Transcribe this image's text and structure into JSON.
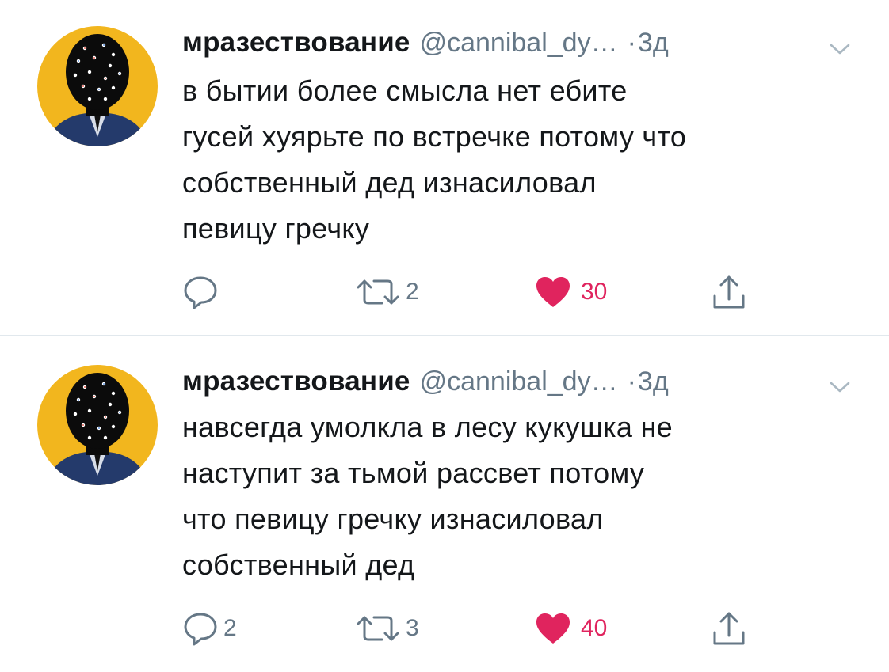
{
  "tweets": [
    {
      "author_name": "мразествование",
      "author_handle": "@cannibal_dy…",
      "separator": "·",
      "time": "3д",
      "text_lines": [
        "в бытии более смысла нет ебите",
        "гусей хуярьте по встречке потому что",
        "собственный дед изнасиловал",
        "певицу гречку"
      ],
      "reply_count": "",
      "retweet_count": "2",
      "like_count": "30",
      "liked": true
    },
    {
      "author_name": "мразествование",
      "author_handle": "@cannibal_dy…",
      "separator": "·",
      "time": "3д",
      "text_lines": [
        "навсегда умолкла в лесу кукушка не",
        "наступит за тьмой рассвет потому",
        "что певицу гречку изнасиловал",
        "собственный дед"
      ],
      "reply_count": "2",
      "retweet_count": "3",
      "like_count": "40",
      "liked": true
    }
  ],
  "icons": {
    "reply": "speech-bubble-icon",
    "retweet": "retweet-arrows-icon",
    "like": "heart-icon",
    "share": "share-upload-icon",
    "menu": "chevron-down-icon"
  },
  "colors": {
    "name": "#14171a",
    "meta": "#657786",
    "like_active": "#e0245e",
    "divider": "#e1e8ed",
    "avatar_bg": "#f2b61e",
    "avatar_figure": "#0b0b0b",
    "avatar_jacket": "#243a6b"
  }
}
